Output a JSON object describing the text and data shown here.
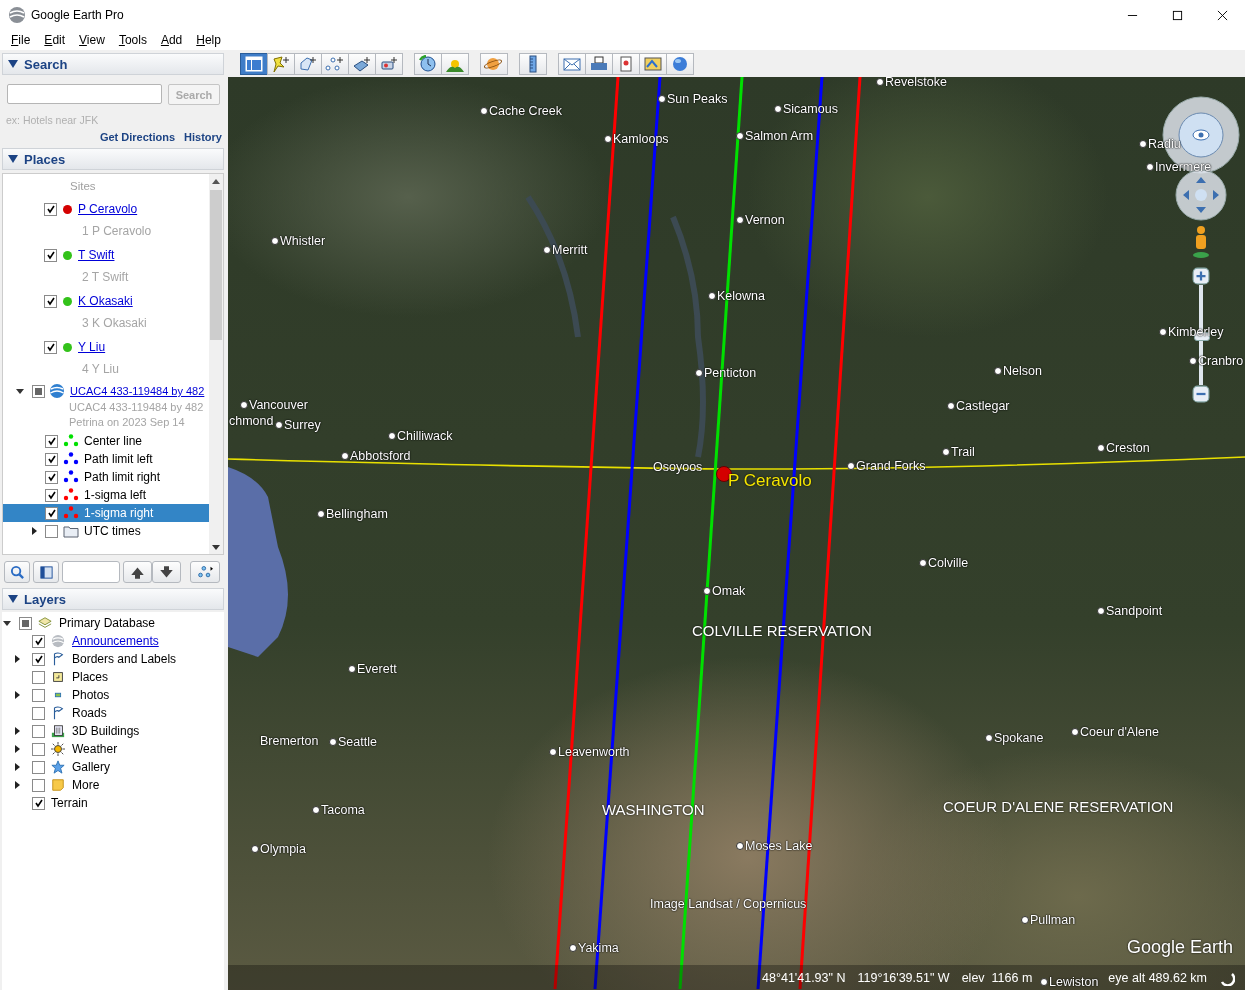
{
  "window": {
    "title": "Google Earth Pro"
  },
  "menu": [
    "File",
    "Edit",
    "View",
    "Tools",
    "Add",
    "Help"
  ],
  "toolbar": {
    "sidebar_shown": true
  },
  "search": {
    "header": "Search",
    "button": "Search",
    "hint": "ex: Hotels near JFK",
    "links": [
      "Get Directions",
      "History"
    ]
  },
  "places": {
    "header": "Places",
    "folder_label": "Sites",
    "sites": [
      {
        "name": "P Ceravolo",
        "description": "1 P Ceravolo",
        "checked": true,
        "color": "#d40000"
      },
      {
        "name": "T Swift",
        "description": "2 T Swift",
        "checked": true,
        "color": "#33c21a"
      },
      {
        "name": "K Okasaki",
        "description": "3 K Okasaki",
        "checked": true,
        "color": "#33c21a"
      },
      {
        "name": "Y Liu",
        "description": "4 Y Liu",
        "checked": true,
        "color": "#33c21a"
      }
    ],
    "event": {
      "name": "UCAC4 433-119484 by 482",
      "description": "UCAC4 433-119484 by 482 Petrina on 2023 Sep 14",
      "expanded": true,
      "checked": false,
      "mixed": true,
      "children": [
        {
          "kind": "path",
          "name": "Center line",
          "checked": true,
          "color": "#00e000",
          "selected": false
        },
        {
          "kind": "path",
          "name": "Path limit left",
          "checked": true,
          "color": "#0000ff",
          "selected": false
        },
        {
          "kind": "path",
          "name": "Path limit right",
          "checked": true,
          "color": "#0000ff",
          "selected": false
        },
        {
          "kind": "path",
          "name": "1-sigma left",
          "checked": true,
          "color": "#ff0000",
          "selected": false
        },
        {
          "kind": "path",
          "name": "1-sigma right",
          "checked": true,
          "color": "#ff0000",
          "selected": true
        },
        {
          "kind": "folder",
          "name": "UTC times",
          "checked": false,
          "expanded": false,
          "selected": false
        }
      ]
    }
  },
  "layers": {
    "header": "Layers",
    "root": {
      "name": "Primary Database",
      "checked": false,
      "mixed": true,
      "expanded": true,
      "children": [
        {
          "name": "Announcements",
          "checked": true,
          "kind": "globe",
          "link": true
        },
        {
          "name": "Borders and Labels",
          "checked": true,
          "kind": "flag",
          "expanded": false
        },
        {
          "name": "Places",
          "checked": false,
          "kind": "square"
        },
        {
          "name": "Photos",
          "checked": false,
          "kind": "photo",
          "expanded": false
        },
        {
          "name": "Roads",
          "checked": false,
          "kind": "flag"
        },
        {
          "name": "3D Buildings",
          "checked": false,
          "kind": "building",
          "expanded": false
        },
        {
          "name": "Weather",
          "checked": false,
          "kind": "sun",
          "expanded": false
        },
        {
          "name": "Gallery",
          "checked": false,
          "kind": "star",
          "expanded": false
        },
        {
          "name": "More",
          "checked": false,
          "kind": "note",
          "expanded": false
        },
        {
          "name": "Terrain",
          "checked": true,
          "kind": "plain"
        }
      ]
    }
  },
  "map": {
    "labels": [
      {
        "kind": "city",
        "text": "Revelstoke"
      },
      {
        "kind": "city",
        "text": "Cache Creek"
      },
      {
        "kind": "city",
        "text": "Sun Peaks"
      },
      {
        "kind": "city",
        "text": "Sicamous"
      },
      {
        "kind": "city",
        "text": "Kamloops"
      },
      {
        "kind": "city",
        "text": "Salmon Arm"
      },
      {
        "kind": "city",
        "text": "Radiu"
      },
      {
        "kind": "city",
        "text": "Invermere"
      },
      {
        "kind": "city",
        "text": "Whistler"
      },
      {
        "kind": "city",
        "text": "Merritt"
      },
      {
        "kind": "city",
        "text": "Vernon"
      },
      {
        "kind": "city",
        "text": "Kelowna"
      },
      {
        "kind": "city",
        "text": "Kimberley"
      },
      {
        "kind": "city",
        "text": "Cranbro"
      },
      {
        "kind": "city",
        "text": "Penticton"
      },
      {
        "kind": "city",
        "text": "Nelson"
      },
      {
        "kind": "city",
        "text": "Vancouver"
      },
      {
        "kind": "city",
        "text": "Castlegar"
      },
      {
        "kind": "plain",
        "text": "chmond"
      },
      {
        "kind": "city",
        "text": "Surrey"
      },
      {
        "kind": "city",
        "text": "Chilliwack"
      },
      {
        "kind": "city",
        "text": "Abbotsford"
      },
      {
        "kind": "city",
        "text": "Trail"
      },
      {
        "kind": "city",
        "text": "Creston"
      },
      {
        "kind": "plain",
        "text": "Osoyoos"
      },
      {
        "kind": "city",
        "text": "Grand Forks"
      },
      {
        "kind": "city",
        "text": "Bellingham"
      },
      {
        "kind": "city",
        "text": "Colville"
      },
      {
        "kind": "city",
        "text": "Omak"
      },
      {
        "kind": "city",
        "text": "Sandpoint"
      },
      {
        "kind": "region",
        "text": "COLVILLE RESERVATION"
      },
      {
        "kind": "city",
        "text": "Everett"
      },
      {
        "kind": "plain",
        "text": "Bremerton"
      },
      {
        "kind": "city",
        "text": "Seattle"
      },
      {
        "kind": "city",
        "text": "Spokane"
      },
      {
        "kind": "city",
        "text": "Coeur d'Alene"
      },
      {
        "kind": "city",
        "text": "Leavenworth"
      },
      {
        "kind": "city",
        "text": "Tacoma"
      },
      {
        "kind": "region",
        "text": "WASHINGTON"
      },
      {
        "kind": "region",
        "text": "COEUR D'ALENE RESERVATION"
      },
      {
        "kind": "city",
        "text": "Moses Lake"
      },
      {
        "kind": "city",
        "text": "Olympia"
      },
      {
        "kind": "city",
        "text": "Pullman"
      },
      {
        "kind": "city",
        "text": "Yakima"
      },
      {
        "kind": "plain",
        "text": "Image Landsat / Copernicus"
      },
      {
        "kind": "city",
        "text": "Lewiston"
      }
    ],
    "marker": {
      "label": "P Ceravolo"
    },
    "zoom": {
      "level": 0.5
    },
    "logo": "Google Earth",
    "status": {
      "lat": "48°41'41.93\" N",
      "lon": "119°16'39.51\" W",
      "elev": "elev  1166 m",
      "eye_alt": "eye alt 489.62 km"
    }
  }
}
